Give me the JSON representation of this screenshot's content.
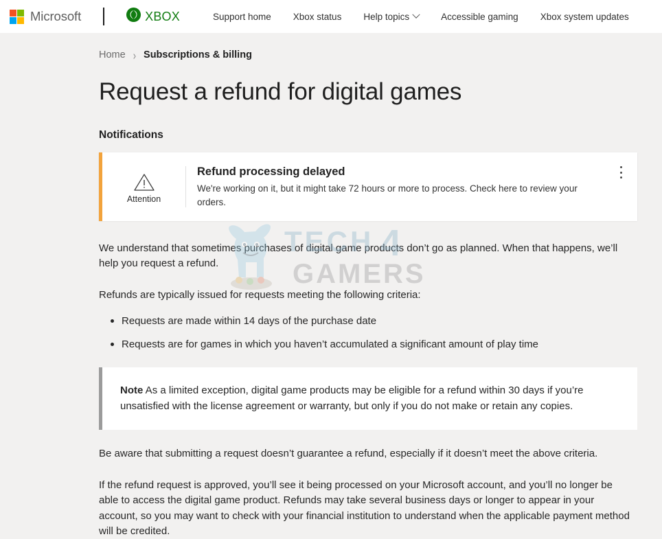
{
  "header": {
    "microsoft_label": "Microsoft",
    "xbox_label": "XBOX",
    "ms_logo_colors": [
      "#f25022",
      "#7fba00",
      "#00a4ef",
      "#ffb900"
    ],
    "xbox_green": "#107c10",
    "nav_items": [
      {
        "label": "Support home",
        "has_chevron": false
      },
      {
        "label": "Xbox status",
        "has_chevron": false
      },
      {
        "label": "Help topics",
        "has_chevron": true
      },
      {
        "label": "Accessible gaming",
        "has_chevron": false
      },
      {
        "label": "Xbox system updates",
        "has_chevron": false
      }
    ]
  },
  "breadcrumb": {
    "home": "Home",
    "separator": "›",
    "current": "Subscriptions & billing"
  },
  "page_title": "Request a refund for digital games",
  "notifications_section": {
    "title": "Notifications",
    "card": {
      "accent_color": "#f2a33c",
      "icon_label": "Attention",
      "heading": "Refund processing delayed",
      "body": "We're working on it, but it might take 72 hours or more to process. Check here to review your orders.",
      "menu_label": "More options"
    }
  },
  "body": {
    "paragraph_1": "We understand that sometimes purchases of digital game products don’t go as planned. When that happens, we’ll help you request a refund.",
    "paragraph_2": "Refunds are typically issued for requests meeting the following criteria:",
    "criteria": [
      "Requests are made within 14 days of the purchase date",
      "Requests are for games in which you haven’t accumulated a significant amount of play time"
    ],
    "note": {
      "label": "Note",
      "accent_color": "#9b9b9b",
      "text": " As a limited exception, digital game products may be eligible for a refund within 30 days if you’re unsatisfied with the license agreement or warranty, but only if you do not make or retain any copies."
    },
    "paragraph_3": "Be aware that submitting a request doesn’t guarantee a refund, especially if it doesn’t meet the above criteria.",
    "paragraph_4": "If the refund request is approved, you’ll see it being processed on your Microsoft account, and you’ll no longer be able to access the digital game product. Refunds may take several business days or longer to appear in your account, so you may want to check with your financial institution to understand when the applicable payment method will be credited."
  },
  "watermark": {
    "text_top": "TECH",
    "text_digit": "4",
    "text_bottom": "GAMERS",
    "color": "#8fb4c9"
  }
}
